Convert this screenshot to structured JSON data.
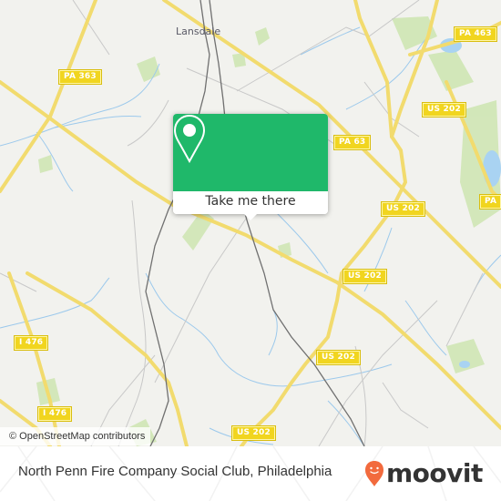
{
  "map": {
    "town_label": "Lansdale",
    "route_shields": [
      {
        "label": "PA 463"
      },
      {
        "label": "PA 363"
      },
      {
        "label": "US 202"
      },
      {
        "label": "PA 63"
      },
      {
        "label": "US 202"
      },
      {
        "label": "PA"
      },
      {
        "label": "US 202"
      },
      {
        "label": "I 476"
      },
      {
        "label": "US 202"
      },
      {
        "label": "I 476"
      },
      {
        "label": "US 202"
      }
    ],
    "attribution": "© OpenStreetMap contributors"
  },
  "popup": {
    "icon": "location-pin-icon",
    "button_label": "Take me there",
    "accent_color": "#1fb86a"
  },
  "footer": {
    "place_name": "North Penn Fire Company Social Club, Philadelphia",
    "brand": "moovit",
    "brand_color": "#f26a3d"
  }
}
